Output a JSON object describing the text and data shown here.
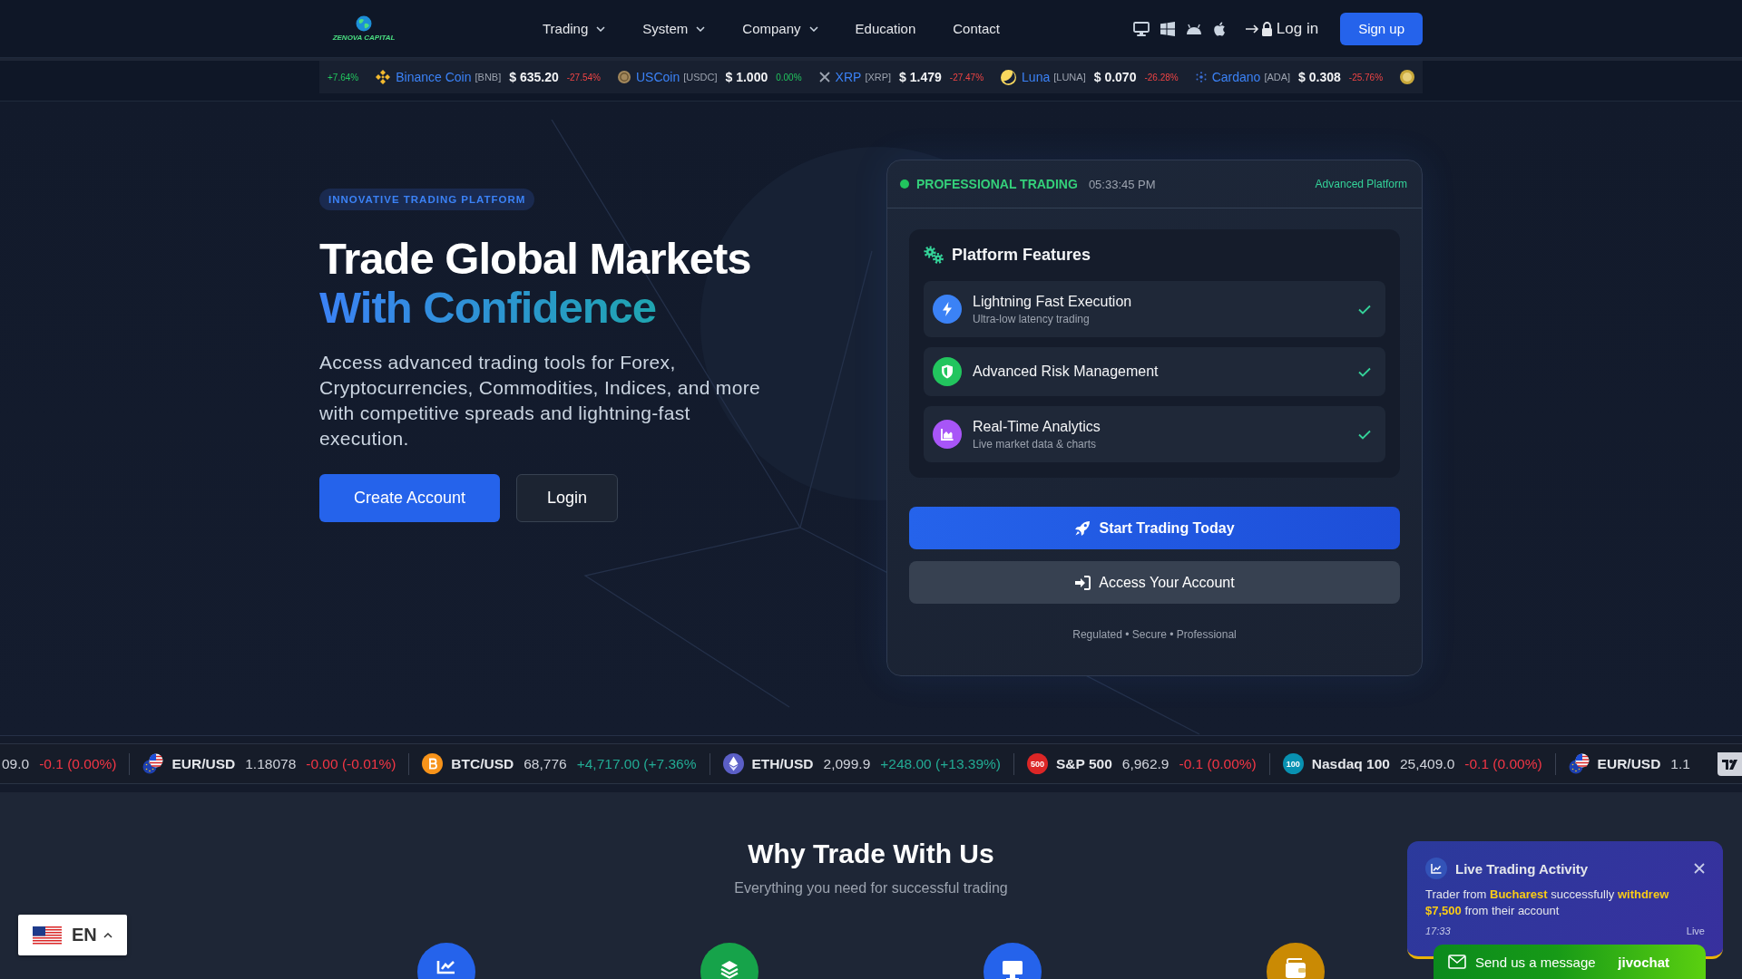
{
  "header": {
    "logo": "ZENOVA CAPITAL",
    "nav": [
      {
        "label": "Trading",
        "dropdown": true
      },
      {
        "label": "System",
        "dropdown": true
      },
      {
        "label": "Company",
        "dropdown": true
      },
      {
        "label": "Education",
        "dropdown": false
      },
      {
        "label": "Contact",
        "dropdown": false
      }
    ],
    "platforms": [
      {
        "kind": "desktop"
      },
      {
        "kind": "windows"
      },
      {
        "kind": "android"
      },
      {
        "kind": "apple"
      }
    ],
    "login": "Log in",
    "signup": "Sign up"
  },
  "coin_ticker": [
    {
      "change": "+7.64%",
      "positive": true
    },
    {
      "kind": "bnb",
      "name": "Binance Coin",
      "symbol": "[BNB]",
      "price": "$ 635.20",
      "change": "-27.54%",
      "positive": false
    },
    {
      "kind": "usdc",
      "name": "USCoin",
      "symbol": "[USDC]",
      "price": "$ 1.000",
      "change": "0.00%",
      "positive": true
    },
    {
      "kind": "xrp",
      "name": "XRP",
      "symbol": "[XRP]",
      "price": "$ 1.479",
      "change": "-27.47%",
      "positive": false
    },
    {
      "kind": "luna",
      "name": "Luna",
      "symbol": "[LUNA]",
      "price": "$ 0.070",
      "change": "-26.28%",
      "positive": false
    },
    {
      "kind": "ada",
      "name": "Cardano",
      "symbol": "[ADA]",
      "price": "$ 0.308",
      "change": "-25.76%",
      "positive": false
    },
    {
      "kind": "doge"
    }
  ],
  "hero": {
    "badge": "INNOVATIVE TRADING PLATFORM",
    "title_line_1": "Trade Global Markets",
    "title_line_2": "With Confidence",
    "description": "Access advanced trading tools for Forex, Cryptocurrencies, Commodities, Indices, and more with competitive spreads and lightning-fast execution.",
    "buttons": [
      {
        "label": "Create Account",
        "kind": "primary"
      },
      {
        "label": "Login",
        "kind": "secondary"
      }
    ]
  },
  "trading_card": {
    "status": "PROFESSIONAL TRADING",
    "time": "05:33:45 PM",
    "tag": "Advanced Platform",
    "features_title": "Platform Features",
    "features": [
      {
        "kind": "bolt",
        "color": "#3b82f6",
        "title": "Lightning Fast Execution",
        "subtitle": "Ultra-low latency trading",
        "checked": true
      },
      {
        "kind": "shield",
        "color": "#22c55e",
        "title": "Advanced Risk Management",
        "checked": true
      },
      {
        "kind": "chart",
        "color": "#a855f7",
        "title": "Real-Time Analytics",
        "subtitle": "Live market data & charts",
        "checked": true
      }
    ],
    "buttons": [
      {
        "label": "Start Trading Today",
        "kind": "primary"
      },
      {
        "label": "Access Your Account",
        "kind": "secondary"
      }
    ],
    "footer": "Regulated • Secure • Professional"
  },
  "market_ticker": [
    {
      "price": "09.0",
      "change": "-0.1 (0.00%)",
      "positive": false
    },
    {
      "kind": "eur-usd",
      "symbol": "EUR/USD",
      "price": "1.18078",
      "change": "-0.00 (-0.01%)",
      "positive": false
    },
    {
      "kind": "btc",
      "symbol": "BTC/USD",
      "price": "68,776",
      "change": "+4,717.00 (+7.36%",
      "positive": true
    },
    {
      "kind": "eth",
      "symbol": "ETH/USD",
      "price": "2,099.9",
      "change": "+248.00 (+13.39%)",
      "positive": true
    },
    {
      "kind": "index",
      "badge": "500",
      "color": "#dc2626",
      "symbol": "S&P 500",
      "price": "6,962.9",
      "change": "-0.1 (0.00%)",
      "positive": false
    },
    {
      "kind": "index",
      "badge": "100",
      "color": "#0891b2",
      "symbol": "Nasdaq 100",
      "price": "25,409.0",
      "change": "-0.1 (0.00%)",
      "positive": false
    },
    {
      "kind": "eur-usd",
      "symbol": "EUR/USD",
      "price": "1.1"
    }
  ],
  "why_section": {
    "title": "Why Trade With Us",
    "subtitle": "Everything you need for successful trading",
    "features": [
      {
        "kind": "chart",
        "color": "#2563eb"
      },
      {
        "kind": "layers",
        "color": "#16a34a"
      },
      {
        "kind": "monitor",
        "color": "#2563eb"
      },
      {
        "kind": "wallet",
        "color": "#ca8a04"
      }
    ]
  },
  "language": {
    "code": "EN"
  },
  "live_activity": {
    "title": "Live Trading Activity",
    "message": "Trader from **Bucharest** successfully **withdrew** **$7,500** from their account",
    "time": "17:33",
    "status": "Live"
  },
  "chat_widget": {
    "label": "Send us a message",
    "brand": "jivochat"
  }
}
